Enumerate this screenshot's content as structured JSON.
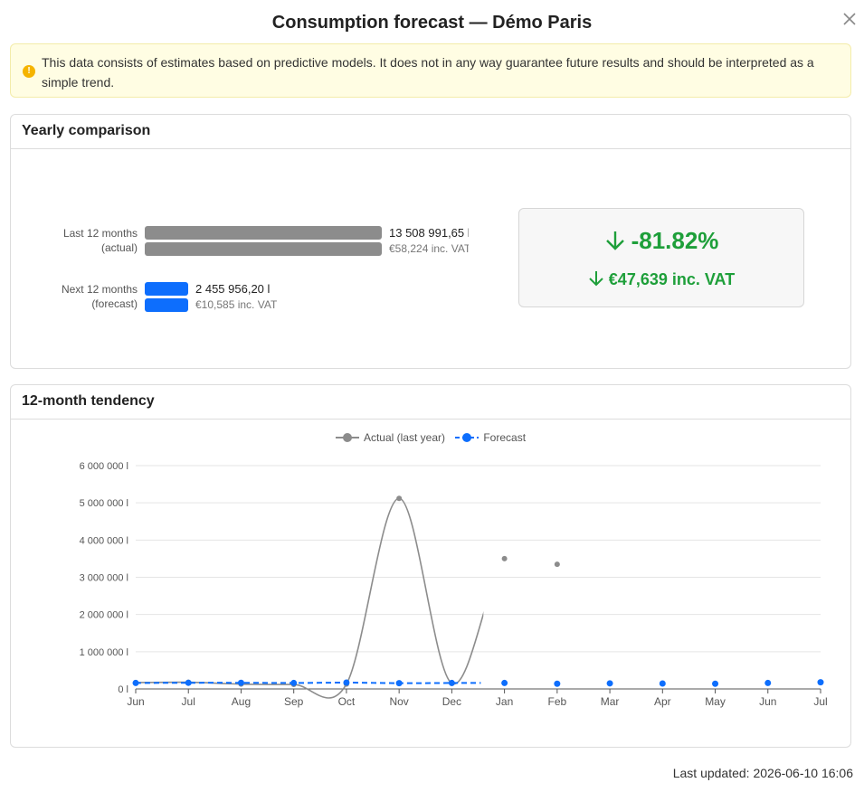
{
  "modal": {
    "title": "Consumption forecast — Démo Paris",
    "close_icon": "close-icon"
  },
  "alert": {
    "icon": "warning-icon",
    "text": "This data consists of estimates based on predictive models. It does not in any way guarantee future results and should be interpreted as a simple trend."
  },
  "yearly": {
    "title": "Yearly comparison",
    "last": {
      "label_line1": "Last 12 months",
      "label_line2": "(actual)",
      "value": "13 508 991,65 l",
      "cost": "€58,224 inc. VAT",
      "color": "#8c8c8c"
    },
    "next": {
      "label_line1": "Next 12 months",
      "label_line2": "(forecast)",
      "value": "2 455 956,20 l",
      "cost": "€10,585 inc. VAT",
      "color": "#0d6efd"
    },
    "delta_percent": "-81.82%",
    "delta_cost": "€47,639 inc. VAT",
    "delta_icon": "arrow-down-icon",
    "delta_color": "#1e9f3a"
  },
  "tendency": {
    "title": "12-month tendency"
  },
  "chart_data": {
    "type": "line",
    "x": [
      "Jun",
      "Jul",
      "Aug",
      "Sep",
      "Oct",
      "Nov",
      "Dec",
      "Jan",
      "Feb",
      "Mar",
      "Apr",
      "May",
      "Jun",
      "Jul"
    ],
    "yticks": [
      "0 l",
      "1 000 000 l",
      "2 000 000 l",
      "3 000 000 l",
      "4 000 000 l",
      "5 000 000 l",
      "6 000 000 l"
    ],
    "ylim": [
      0,
      6000000
    ],
    "series": [
      {
        "name": "Actual (last year)",
        "color": "#8c8c8c",
        "values": [
          170000,
          180000,
          130000,
          120000,
          130000,
          5120000,
          150000,
          3500000,
          3350000,
          null,
          null,
          null,
          null,
          null
        ]
      },
      {
        "name": "Forecast",
        "color": "#0d6efd",
        "values": [
          160000,
          165000,
          165000,
          160000,
          170000,
          155000,
          160000,
          160000,
          140000,
          150000,
          145000,
          140000,
          160000,
          180000
        ]
      }
    ],
    "grid": true,
    "legend": "top-center"
  },
  "footer": {
    "last_updated": "Last updated: 2026-06-10 16:06"
  }
}
